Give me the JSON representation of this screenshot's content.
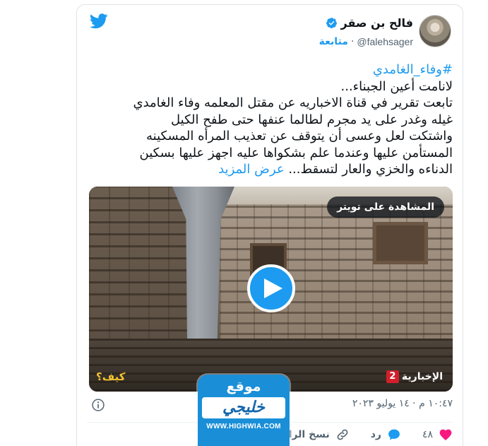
{
  "author": {
    "name": "فالح بن صقر",
    "handle": "@falehsager",
    "separator": "·",
    "follow_label": "متابعة"
  },
  "tweet": {
    "hashtag": "#وفاء_الغامدي",
    "lines": [
      "لانامت أعين الجبناء...",
      "تابعت تقرير في قناة الاخباريه عن مقتل المعلمه وفاء الغامدي",
      "غيله وغدر على يد مجرم لطالما عنفها حتى طفح الكيل",
      "واشتكت لعل وعسى أن يتوقف عن تعذيب المرأه المسكينه",
      "المستأمن عليها وعندما علم بشكواها عليه اجهز عليها بسكين",
      "الدناءه والخزي والعار لتسقط..."
    ],
    "more_label": "عرض المزيد"
  },
  "media": {
    "watch_label": "المشاهدة على تويتر",
    "channel_name": "الإخبارية",
    "channel_number": "2",
    "corner_text": "كيف؟"
  },
  "meta": {
    "timestamp": "١٠:٤٧ م · ١٤ يوليو ٢٠٢٣"
  },
  "actions": {
    "like_count": "٤٨",
    "reply_label": "رد",
    "copy_label": "نسخ الرا"
  },
  "watermark": {
    "top": "موقع",
    "brand": "خليجي",
    "url": "WWW.HIGHWIA.COM"
  },
  "colors": {
    "twitter_blue": "#1d9bf0",
    "like_red": "#f91880",
    "text_primary": "#0f1419",
    "text_secondary": "#536471"
  }
}
